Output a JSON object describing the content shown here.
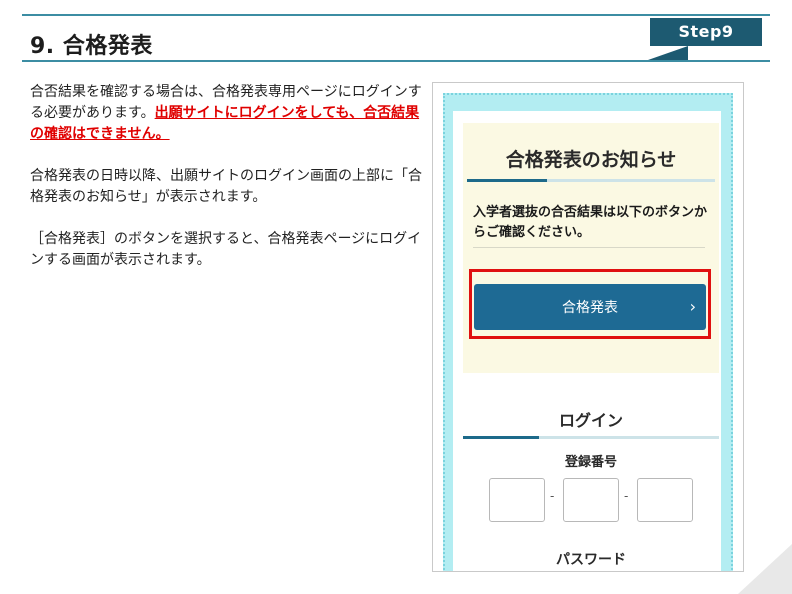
{
  "header": {
    "title": "9. 合格発表",
    "step_label": "Step9"
  },
  "body": {
    "para1_prefix": "合否結果を確認する場合は、合格発表専用ページにログインする必要があります。",
    "para1_warning": "出願サイトにログインをしても、合否結果の確認はできません。",
    "para2": "合格発表の日時以降、出願サイトのログイン画面の上部に「合格発表のお知らせ」が表示されます。",
    "para3": "［合格発表］のボタンを選択すると、合格発表ページにログインする画面が表示されます。"
  },
  "phone": {
    "notice_title": "合格発表のお知らせ",
    "notice_body": "入学者選抜の合否結果は以下のボタンからご確認ください。",
    "result_button_label": "合格発表",
    "result_button_chevron": "›",
    "login_title": "ログイン",
    "reg_number_label": "登録番号",
    "reg_dash": "-",
    "password_label": "パスワード"
  },
  "colors": {
    "accent_teal": "#1d5a71",
    "button_blue": "#1e6a94",
    "warning_red": "#e00000",
    "highlight_red": "#e01010",
    "notice_bg": "#fbf9e3",
    "phone_bg": "#b3edf2"
  }
}
